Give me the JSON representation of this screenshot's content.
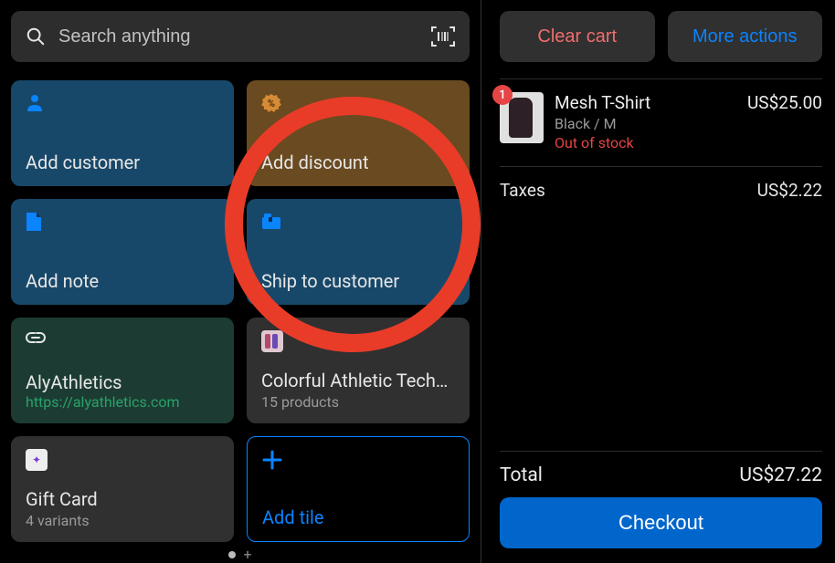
{
  "search": {
    "placeholder": "Search anything"
  },
  "tiles": [
    {
      "label": "Add customer"
    },
    {
      "label": "Add discount"
    },
    {
      "label": "Add note"
    },
    {
      "label": "Ship to customer"
    },
    {
      "label": "AlyAthletics",
      "sub": "https://alyathletics.com"
    },
    {
      "label": "Colorful Athletic Tech…",
      "sub": "15 products"
    },
    {
      "label": "Gift Card",
      "sub": "4 variants"
    },
    {
      "label": "Add tile"
    }
  ],
  "topButtons": {
    "clear": "Clear cart",
    "more": "More actions"
  },
  "cart": {
    "items": [
      {
        "qty": "1",
        "name": "Mesh T-Shirt",
        "variant": "Black / M",
        "stock": "Out of stock",
        "price": "US$25.00"
      }
    ],
    "taxesLabel": "Taxes",
    "taxesValue": "US$2.22"
  },
  "totals": {
    "label": "Total",
    "value": "US$27.22",
    "checkout": "Checkout"
  }
}
